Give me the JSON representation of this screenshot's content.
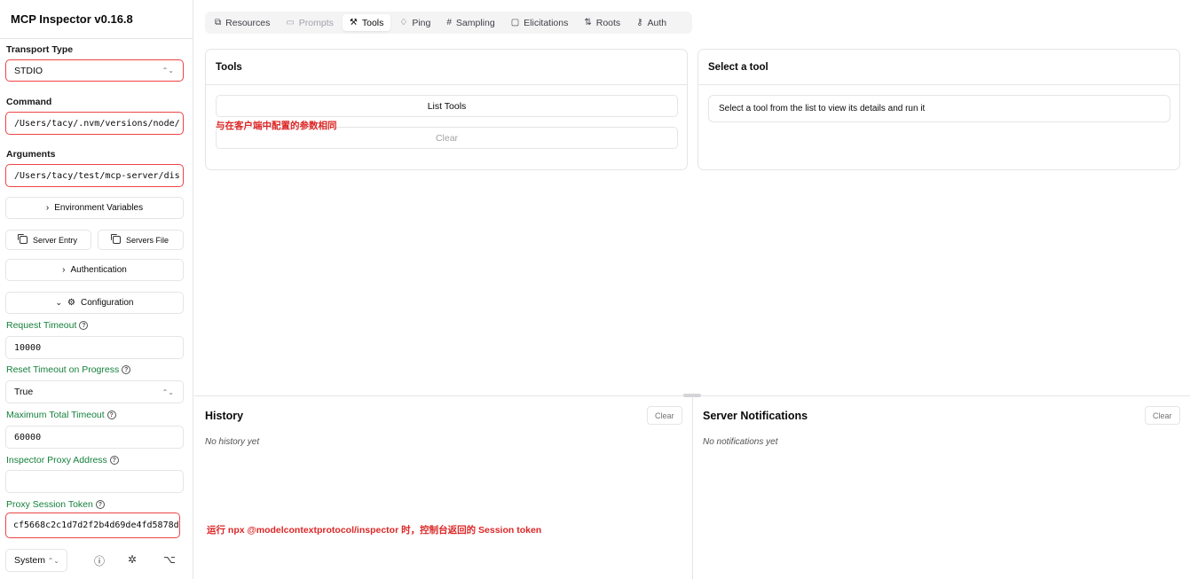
{
  "sidebar": {
    "title": "MCP Inspector v0.16.8",
    "transport_label": "Transport Type",
    "transport_value": "STDIO",
    "command_label": "Command",
    "command_value": "/Users/tacy/.nvm/versions/node/",
    "arguments_label": "Arguments",
    "arguments_value": "/Users/tacy/test/mcp-server/dis",
    "env_vars_label": "Environment Variables",
    "server_entry_label": "Server Entry",
    "servers_file_label": "Servers File",
    "authentication_label": "Authentication",
    "configuration_label": "Configuration",
    "request_timeout_label": "Request Timeout",
    "request_timeout_value": "10000",
    "reset_timeout_label": "Reset Timeout on Progress",
    "reset_timeout_value": "True",
    "max_timeout_label": "Maximum Total Timeout",
    "max_timeout_value": "60000",
    "proxy_address_label": "Inspector Proxy Address",
    "proxy_address_value": "",
    "session_token_label": "Proxy Session Token",
    "session_token_value": "cf5668c2c1d7d2f2b4d69de4fd5878d",
    "theme_value": "System"
  },
  "tabs": [
    {
      "label": "Resources",
      "icon": "resources-icon"
    },
    {
      "label": "Prompts",
      "icon": "prompts-icon"
    },
    {
      "label": "Tools",
      "icon": "tools-icon"
    },
    {
      "label": "Ping",
      "icon": "bell-icon"
    },
    {
      "label": "Sampling",
      "icon": "hash-icon"
    },
    {
      "label": "Elicitations",
      "icon": "message-icon"
    },
    {
      "label": "Roots",
      "icon": "roots-icon"
    },
    {
      "label": "Auth",
      "icon": "key-icon"
    }
  ],
  "tools_panel": {
    "title": "Tools",
    "list_tools_label": "List Tools",
    "clear_label": "Clear"
  },
  "select_panel": {
    "title": "Select a tool",
    "hint": "Select a tool from the list to view its details and run it"
  },
  "annotations": {
    "config_note": "与在客户端中配置的参数相同",
    "token_note": "运行 npx @modelcontextprotocol/inspector 时，控制台返回的 Session token"
  },
  "history": {
    "title": "History",
    "clear_label": "Clear",
    "empty": "No history yet"
  },
  "notifications": {
    "title": "Server Notifications",
    "clear_label": "Clear",
    "empty": "No notifications yet"
  },
  "colors": {
    "accent_green": "#16803c",
    "annotation_red": "#dc2626",
    "highlight_border": "#ef4444"
  }
}
